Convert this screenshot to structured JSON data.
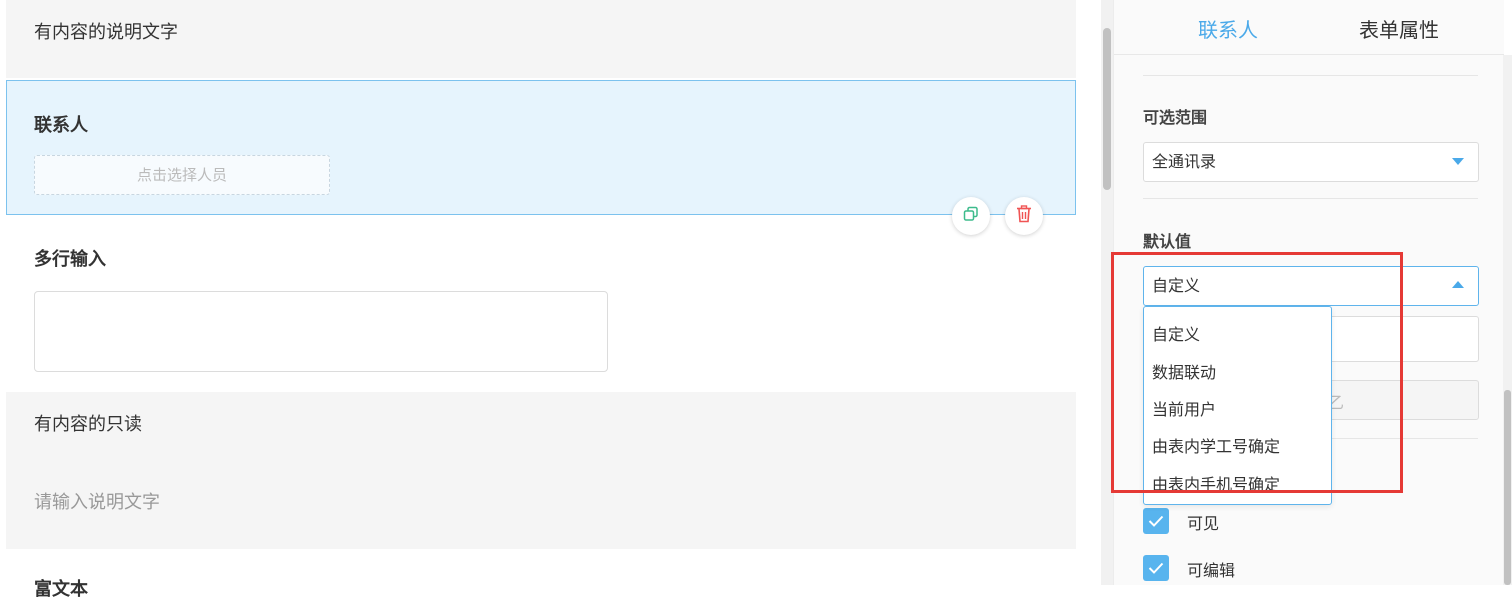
{
  "canvas": {
    "description_block": {
      "text": "有内容的说明文字"
    },
    "contact_block": {
      "label": "联系人",
      "picker_placeholder": "点击选择人员"
    },
    "multiline": {
      "label": "多行输入"
    },
    "readonly_block": {
      "title": "有内容的只读",
      "placeholder": "请输入说明文字"
    },
    "next_label_partial": "富文本"
  },
  "panel": {
    "tabs": [
      {
        "label": "联系人",
        "active": true
      },
      {
        "label": "表单属性",
        "active": false
      }
    ],
    "range": {
      "label": "可选范围",
      "value": "全通讯录"
    },
    "default_value": {
      "label": "默认值",
      "value": "自定义",
      "options": [
        "自定义",
        "数据联动",
        "当前用户",
        "由表内学工号确定",
        "由表内手机号确定"
      ]
    },
    "hidden_field_fragment": "乙",
    "checkboxes": [
      {
        "label": "可见",
        "checked": true
      },
      {
        "label": "可编辑",
        "checked": true
      }
    ]
  },
  "colors": {
    "accent": "#4aa9e9",
    "selected_block_bg": "#e6f4fd",
    "delete_red": "#f05454",
    "copy_green": "#3dbb8c",
    "annotation_red": "#e53935"
  }
}
